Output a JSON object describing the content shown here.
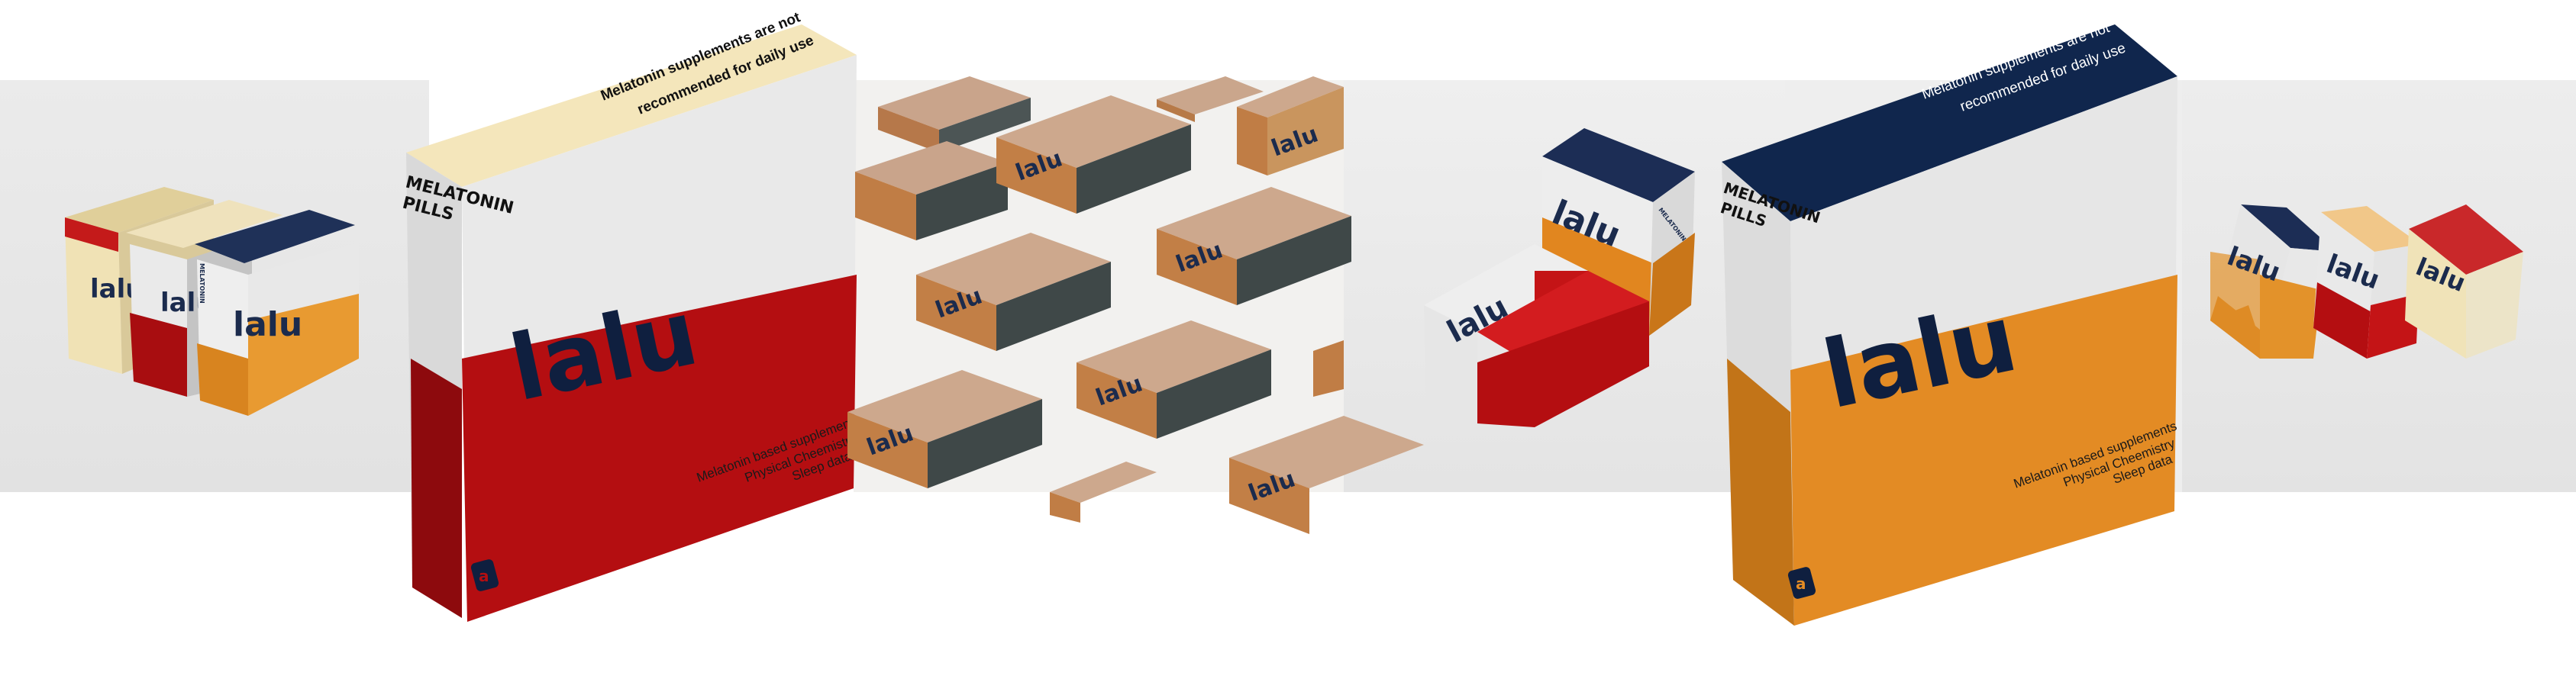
{
  "brand": {
    "logo": "lalu",
    "product_line_1": "MELATONIN",
    "product_line_2": "PILLS",
    "warning_line_1": "Melatonin supplements are not",
    "warning_line_2": "recommended for daily use",
    "feature_1": "Melatonin based supplements",
    "feature_2": "Physical Cheemistry",
    "feature_3": "Sleep data",
    "emblem": "a"
  },
  "colors": {
    "cream": "#f3e4b7",
    "red": "#b00d10",
    "orange": "#e28a22",
    "navy": "#0f2347",
    "white_band": "#e8e8e8",
    "text_dark": "#1b2b4d"
  }
}
